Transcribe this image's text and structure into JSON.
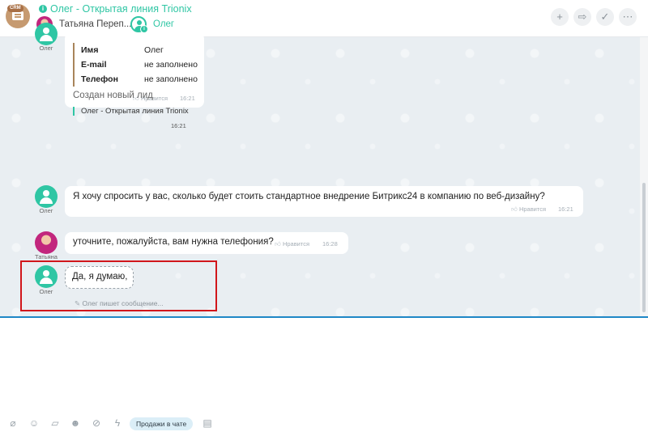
{
  "header": {
    "crm_badge": "CRM",
    "title": "Олег - Открытая линия Trionix",
    "participants": [
      {
        "name": "Татьяна Переп..."
      },
      {
        "name": "Олег"
      }
    ],
    "actions": [
      {
        "icon": "plus-icon",
        "glyph": "+"
      },
      {
        "icon": "forward-icon",
        "glyph": "⇨"
      },
      {
        "icon": "check-circle-icon",
        "glyph": "✓"
      },
      {
        "icon": "more-icon",
        "glyph": "⋯"
      }
    ]
  },
  "messages": {
    "card": {
      "author": "Олег",
      "rows": [
        {
          "key": "Имя",
          "value": "Олег"
        },
        {
          "key": "E-mail",
          "value": "не заполнено"
        },
        {
          "key": "Телефон",
          "value": "не заполнено"
        }
      ],
      "like": "Нравится",
      "time": "16:21"
    },
    "lead": {
      "title": "Создан новый лид",
      "link": "Олег - Открытая линия Trionix",
      "time": "16:21"
    },
    "msg1": {
      "author": "Олег",
      "text": "Я хочу спросить у вас, сколько будет стоить стандартное внедрение Битрикс24 в компанию по веб-дизайну?",
      "like": "Нравится",
      "time": "16:21"
    },
    "msg2": {
      "author": "Татьяна",
      "text": "уточните, пожалуйста, вам нужна телефония?",
      "like": "Нравится",
      "time": "16:28"
    },
    "typing": {
      "author": "Олег",
      "text": "Да, я думаю,",
      "note": "Олег пишет сообщение..."
    }
  },
  "footer": {
    "icons": [
      "attach-icon",
      "user-icon",
      "edit-icon",
      "smile-icon",
      "eye-off-icon",
      "lightning-icon"
    ],
    "sales_button": "Продажи в чате",
    "last_icon": "document-icon"
  },
  "colors": {
    "accent": "#2fc6a4",
    "highlight_box": "#d1161b",
    "chat_bg": "#e9eef2",
    "divider": "#1f87c6"
  }
}
